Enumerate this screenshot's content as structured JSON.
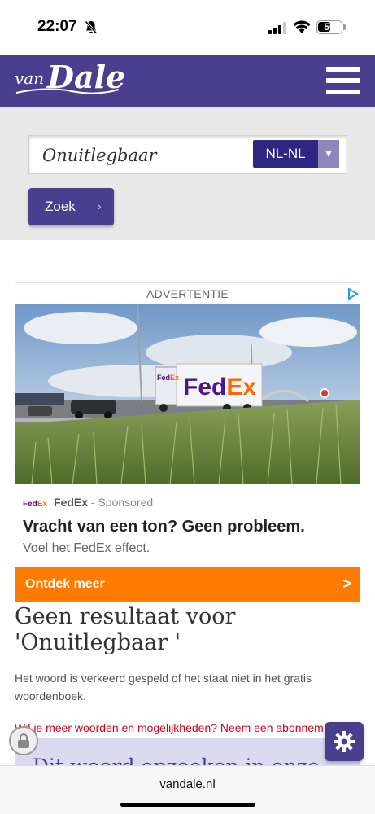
{
  "status_bar": {
    "time": "22:07",
    "battery": "56",
    "battery_level": 0.56,
    "icons": [
      "bell-slash-icon",
      "cellular-signal-icon",
      "wifi-icon",
      "battery-icon"
    ]
  },
  "header": {
    "logo_van": "van",
    "logo_dale": "Dale",
    "menu_icon": "hamburger-menu-icon"
  },
  "search": {
    "value": "Onuitlegbaar",
    "language": "NL-NL",
    "button_label": "Zoek"
  },
  "ad": {
    "label": "ADVERTENTIE",
    "trailer_brand_fed": "Fed",
    "trailer_brand_ex": "Ex",
    "sponsor_logo_fed": "Fed",
    "sponsor_logo_ex": "Ex",
    "sponsor_name": "FedEx",
    "sponsored_text": " - Sponsored",
    "headline": "Vracht van een ton? Geen probleem.",
    "subline": "Voel het FedEx effect.",
    "cta_label": "Ontdek meer",
    "cta_arrow": ">"
  },
  "result": {
    "title": "Geen resultaat voor 'Onuitlegbaar '",
    "description": "Het woord is verkeerd gespeld of het staat niet in het gratis woordenboek.",
    "upsell_link": "Wil je meer woorden en mogelijkheden? Neem een abonnem",
    "promo_text": "Dit woord opzoeken in onze"
  },
  "browser": {
    "url": "vandale.nl"
  },
  "colors": {
    "brand_purple": "#4a3f8f",
    "lang_navy": "#2e2680",
    "cta_orange": "#ff7a00",
    "fedex_purple": "#4d148c",
    "fedex_orange": "#ff6600",
    "link_red": "#d0021b"
  }
}
